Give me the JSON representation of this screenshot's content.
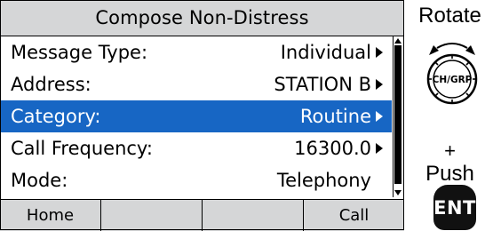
{
  "screen": {
    "title": "Compose Non-Distress",
    "rows": [
      {
        "label": "Message Type:",
        "value": "Individual",
        "has_arrow": true,
        "selected": false
      },
      {
        "label": "Address:",
        "value": "STATION B",
        "has_arrow": true,
        "selected": false
      },
      {
        "label": "Category:",
        "value": "Routine",
        "has_arrow": true,
        "selected": true
      },
      {
        "label": "Call Frequency:",
        "value": "16300.0",
        "has_arrow": true,
        "selected": false
      },
      {
        "label": "Mode:",
        "value": "Telephony",
        "has_arrow": false,
        "selected": false
      }
    ],
    "softkeys": [
      "Home",
      "",
      "",
      "Call"
    ]
  },
  "controls": {
    "rotate_label": "Rotate",
    "knob_label": "CH/GRP",
    "plus": "+",
    "push_label": "Push",
    "ent_label": "ENT"
  },
  "colors": {
    "selection": "#1766c4",
    "title_bar": "#d5d6d7",
    "softkey_bar": "#d5d6d7"
  },
  "icons": [
    "right-arrow-icon",
    "scroll-up-icon",
    "scroll-down-icon",
    "rotate-arrows-icon"
  ]
}
